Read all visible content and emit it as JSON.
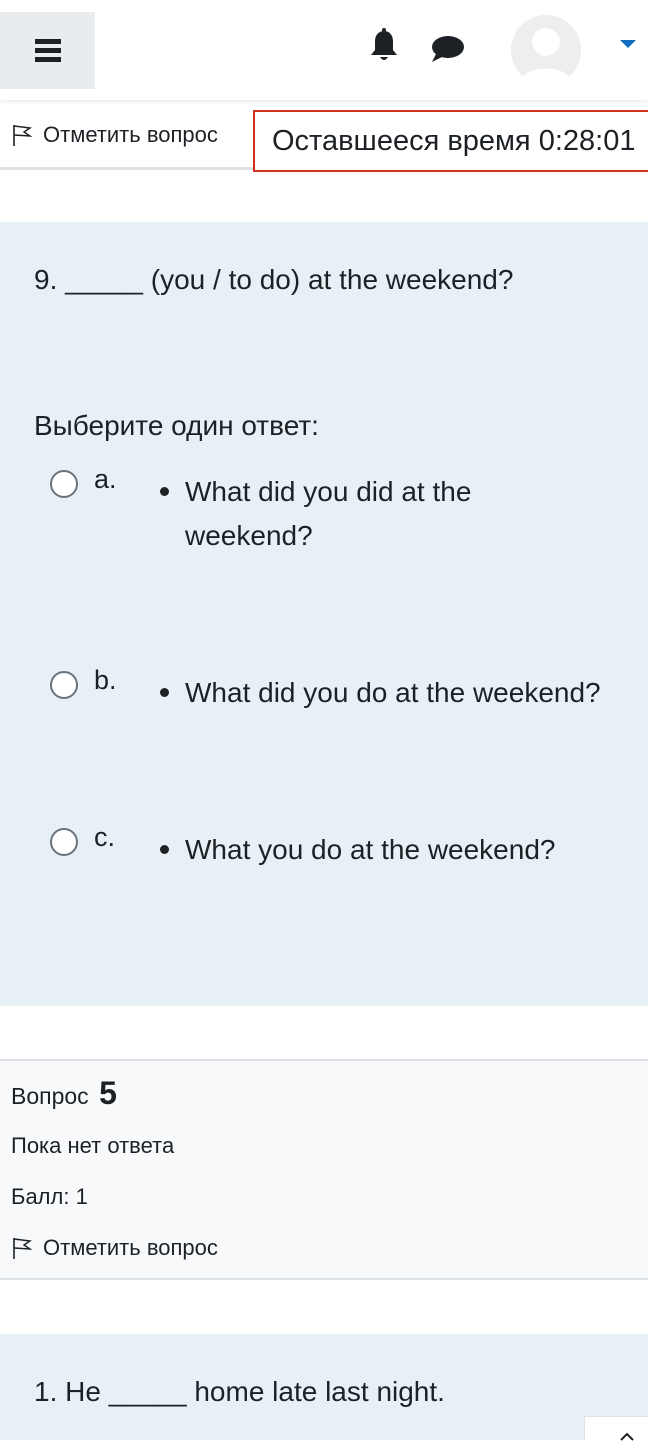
{
  "navbar": {
    "menu_icon": "hamburger-icon",
    "bell_icon": "bell-icon",
    "chat_icon": "chat-icon",
    "avatar_icon": "user-avatar",
    "menu_caret_icon": "caret-down-icon",
    "accent_color": "#0f6cbf"
  },
  "quiz_top": {
    "flag_label": "Отметить вопрос",
    "timer_text": "Оставшееся время 0:28:01",
    "timer_border_color": "#ca3120"
  },
  "question4": {
    "text": "9. _____ (you / to do) at the weekend?",
    "prompt": "Выберите один ответ:",
    "options": [
      {
        "letter": "a.",
        "text": "What did you did at the weekend?"
      },
      {
        "letter": "b.",
        "text": "What did you do at the weekend?"
      },
      {
        "letter": "c.",
        "text": "What you do at the weekend?"
      }
    ],
    "background_color": "#e7f1f5"
  },
  "question5": {
    "label": "Вопрос",
    "number": "5",
    "state": "Пока нет ответа",
    "grade": "Балл: 1",
    "flag_label": "Отметить вопрос",
    "text": "1. He _____ home late last night."
  }
}
